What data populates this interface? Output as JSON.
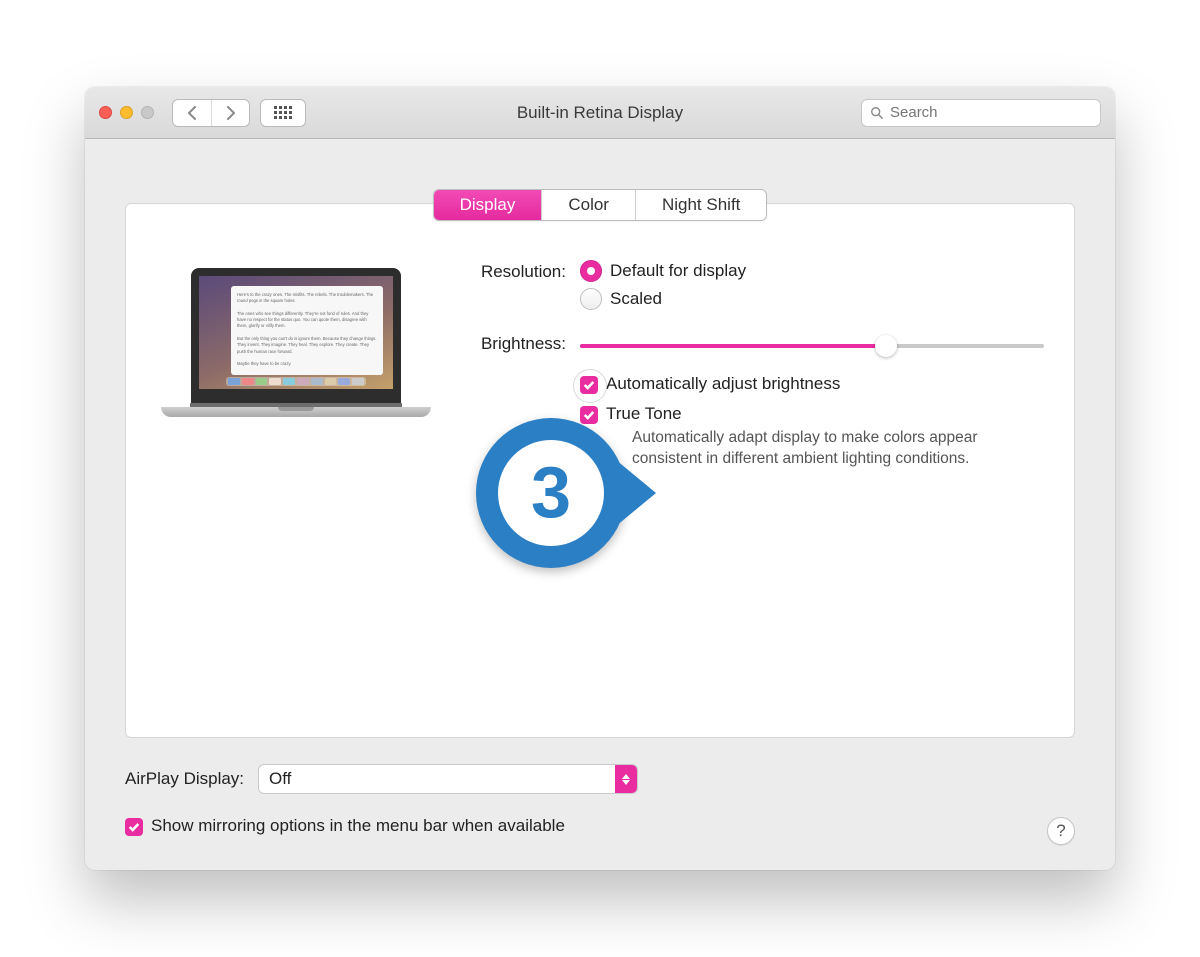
{
  "window": {
    "title": "Built-in Retina Display"
  },
  "search": {
    "placeholder": "Search"
  },
  "tabs": [
    {
      "label": "Display",
      "active": true
    },
    {
      "label": "Color",
      "active": false
    },
    {
      "label": "Night Shift",
      "active": false
    }
  ],
  "resolution": {
    "label": "Resolution:",
    "options": [
      {
        "label": "Default for display",
        "checked": true
      },
      {
        "label": "Scaled",
        "checked": false
      }
    ]
  },
  "brightness": {
    "label": "Brightness:",
    "percent": 66
  },
  "auto_brightness": {
    "label": "Automatically adjust brightness",
    "checked": true
  },
  "true_tone": {
    "label": "True Tone",
    "checked": true,
    "description": "Automatically adapt display to make colors appear consistent in different ambient lighting conditions."
  },
  "callout": {
    "number": "3"
  },
  "airplay": {
    "label": "AirPlay Display:",
    "value": "Off"
  },
  "mirroring": {
    "label": "Show mirroring options in the menu bar when available",
    "checked": true
  },
  "help": {
    "label": "?"
  },
  "colors": {
    "accent": "#e92da0",
    "callout": "#2b7fc5"
  }
}
